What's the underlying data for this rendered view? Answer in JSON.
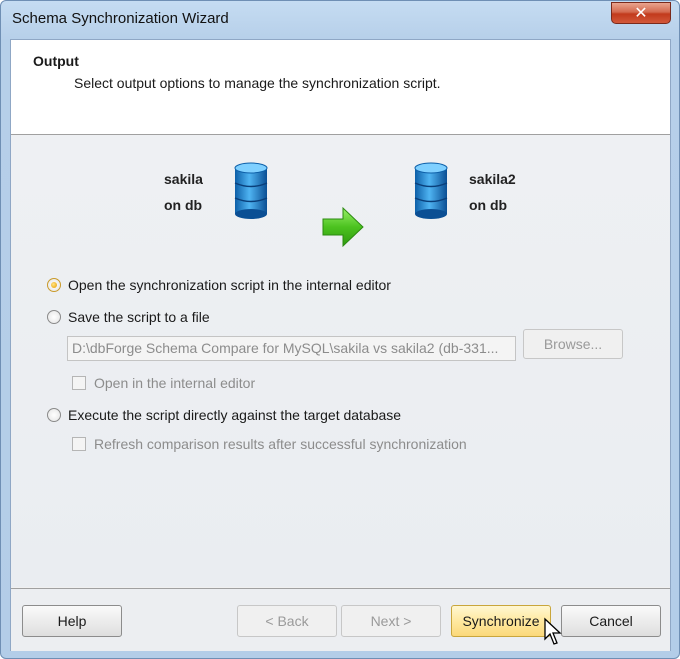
{
  "window": {
    "title": "Schema Synchronization Wizard",
    "close_glyph": "✕"
  },
  "header": {
    "title": "Output",
    "subtitle": "Select output options to manage the synchronization script."
  },
  "source": {
    "name": "sakila",
    "server": "on db",
    "icon": "database-icon"
  },
  "target": {
    "name": "sakila2",
    "server": "on db",
    "icon": "database-icon"
  },
  "arrow_icon": "arrow-right-icon",
  "options": {
    "open_internal": {
      "label": "Open the synchronization script in the internal editor",
      "checked": true
    },
    "save_file": {
      "label": "Save the script to a file",
      "checked": false
    },
    "file_path": "D:\\dbForge Schema Compare for MySQL\\sakila vs sakila2 (db-331...",
    "browse_label": "Browse...",
    "open_in_editor": {
      "label": "Open in the internal editor",
      "checked": false
    },
    "execute_direct": {
      "label": "Execute the script directly against the target database",
      "checked": false
    },
    "refresh_results": {
      "label": "Refresh comparison results after successful synchronization",
      "checked": false
    }
  },
  "buttons": {
    "help": "Help",
    "back": "< Back",
    "next": "Next >",
    "synchronize": "Synchronize",
    "cancel": "Cancel"
  },
  "colors": {
    "accent_primary_button": "#ffe9a0",
    "arrow_green": "#4cc21f",
    "db_blue": "#1e88d8"
  }
}
